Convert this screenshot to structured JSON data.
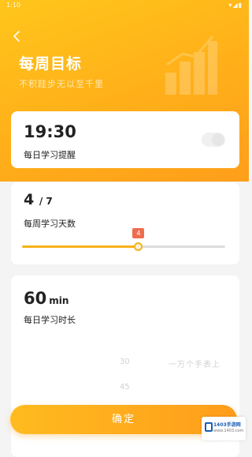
{
  "status_bar": {
    "time": "1:10",
    "icons": "▾◢▮"
  },
  "header": {
    "title": "每周目标",
    "subtitle": "不积跬步无以至千里"
  },
  "reminder": {
    "time": "19:30",
    "label": "每日学习提醒",
    "enabled": false
  },
  "weekly_days": {
    "value": "4",
    "total": "/ 7",
    "label": "每周学习天数",
    "slider_value": 4,
    "slider_max": 7,
    "tooltip": "4",
    "accent_color": "#f7b21a",
    "tooltip_color": "#ef6c4f"
  },
  "daily_duration": {
    "value": "60",
    "unit": "min",
    "label": "每日学习时长",
    "picker_options": [
      "30",
      "45"
    ],
    "picker_hint": "一万个手表上"
  },
  "footer": {
    "confirm_label": "确定"
  },
  "badge": {
    "name": "1403手游网",
    "url": "www.1403.com"
  },
  "icons": {
    "back": "chevron-left-icon",
    "chart": "bar-chart-icon",
    "toggle": "toggle-switch"
  }
}
